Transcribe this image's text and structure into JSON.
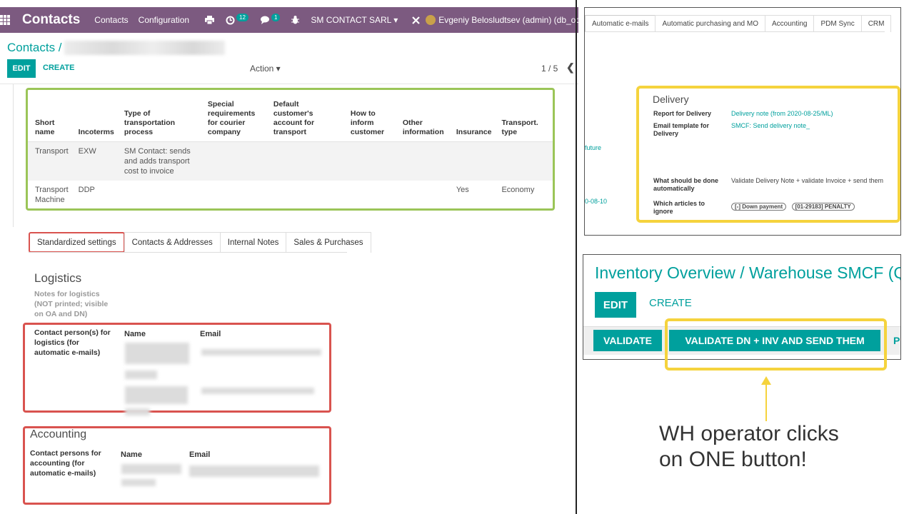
{
  "navbar": {
    "app_title": "Contacts",
    "links": [
      "Contacts",
      "Configuration"
    ],
    "badge_activity": "12",
    "badge_messages": "1",
    "company": "SM CONTACT SARL",
    "company_caret": "▾",
    "user": "Evgeniy Belosludtsev (admin) (db_od"
  },
  "breadcrumb": {
    "root": "Contacts /"
  },
  "control": {
    "edit": "EDIT",
    "create": "CREATE",
    "action": "Action ▾",
    "pager": "1 / 5",
    "prev": "❮"
  },
  "transport_table": {
    "headers": [
      "Short name",
      "Incoterms",
      "Type of transportation process",
      "Special requirements for courier company",
      "Default customer's account for transport",
      "How to inform customer",
      "Other information",
      "Insurance",
      "Transport. type"
    ],
    "rows": [
      [
        "Transport",
        "EXW",
        "SM Contact: sends and adds transport cost to invoice",
        "",
        "",
        "",
        "",
        "",
        ""
      ],
      [
        "Transport Machine",
        "DDP",
        "",
        "",
        "",
        "",
        "",
        "Yes",
        "Economy"
      ]
    ]
  },
  "tabs": [
    "Standardized settings",
    "Contacts & Addresses",
    "Internal Notes",
    "Sales & Purchases"
  ],
  "logistics": {
    "title": "Logistics",
    "notes": "Notes for logistics (NOT printed; visible on OA and DN)",
    "contact_label": "Contact person(s) for logistics (for automatic e-mails)",
    "col_name": "Name",
    "col_email": "Email"
  },
  "accounting": {
    "title": "Accounting",
    "contact_label": "Contact persons for accounting (for automatic e-mails)",
    "col_name": "Name",
    "col_email": "Email"
  },
  "right_top": {
    "tabs": [
      "Automatic e-mails",
      "Automatic purchasing and MO",
      "Accounting",
      "PDM Sync",
      "CRM"
    ],
    "left_fragments": [
      "future",
      "0-08-10"
    ],
    "delivery": {
      "title": "Delivery",
      "report_label": "Report for Delivery",
      "report_value": "Delivery note (from 2020-08-25/ML)",
      "email_label": "Email template for Delivery",
      "email_value": "SMCF: Send delivery note_",
      "auto_label": "What should be done automatically",
      "auto_value": "Validate Delivery Note + validate Invoice + send them",
      "ignore_label": "Which articles to ignore",
      "ignore_tags": [
        "[-] Down payment",
        "[01-29183] PENALTY"
      ]
    }
  },
  "right_bottom": {
    "title": "Inventory Overview / Warehouse SMCF (Qu",
    "edit": "EDIT",
    "create": "CREATE",
    "validate": "VALIDATE",
    "validate_dn": "VALIDATE DN + INV AND SEND THEM",
    "next_fragment": "P"
  },
  "caption": {
    "line1": "WH operator clicks",
    "line2": "on ONE button!"
  },
  "colors": {
    "navbar": "#7c5a80",
    "primary": "#00a09d",
    "highlight_green": "#9bc558",
    "highlight_red": "#d9534f",
    "highlight_yellow": "#f5d33d"
  }
}
